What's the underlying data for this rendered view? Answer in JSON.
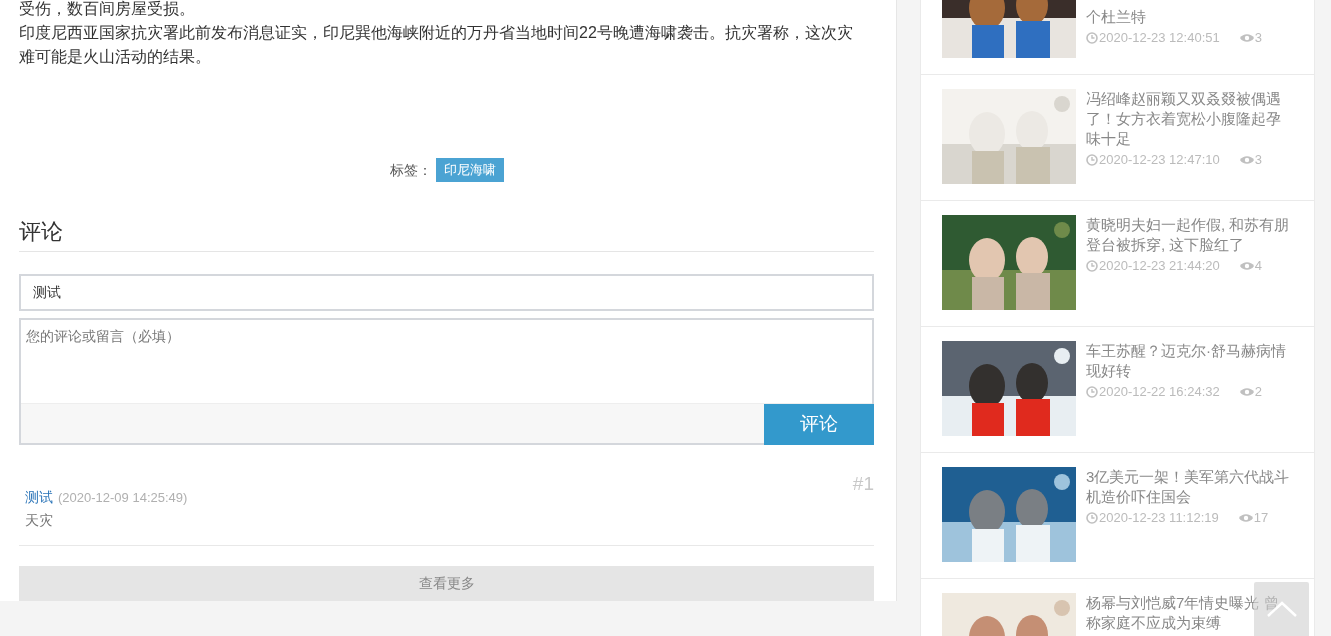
{
  "article": {
    "paragraphs": [
      "受伤，数百间房屋受损。",
      "印度尼西亚国家抗灾署此前发布消息证实，印尼巽他海峡附近的万丹省当地时间22号晚遭海啸袭击。抗灾署称，这次灾难可能是火山活动的结果。"
    ],
    "tags_label": "标签：",
    "tags": [
      "印尼海啸"
    ]
  },
  "comments": {
    "heading": "评论",
    "name_value": "测试",
    "message_placeholder": "您的评论或留言（必填）",
    "submit": "评论",
    "items": [
      {
        "number": "#1",
        "author": "测试",
        "time": "(2020-12-09 14:25:49)",
        "text": "天灾"
      }
    ],
    "more": "查看更多"
  },
  "sidebar": {
    "items": [
      {
        "title": "个杜兰特",
        "time": "2020-12-23 12:40:51",
        "views": "3"
      },
      {
        "title": "冯绍峰赵丽颖又双叒叕被偶遇了！女方衣着宽松小腹隆起孕味十足",
        "time": "2020-12-23 12:47:10",
        "views": "3"
      },
      {
        "title": "黄晓明夫妇一起作假, 和苏有朋登台被拆穿, 这下脸红了",
        "time": "2020-12-23 21:44:20",
        "views": "4"
      },
      {
        "title": "车王苏醒？迈克尔·舒马赫病情现好转",
        "time": "2020-12-22 16:24:32",
        "views": "2"
      },
      {
        "title": "3亿美元一架！美军第六代战斗机造价吓住国会",
        "time": "2020-12-23 11:12:19",
        "views": "17"
      },
      {
        "title": "杨幂与刘恺威7年情史曝光 曾称家庭不应成为束缚"
      }
    ]
  }
}
